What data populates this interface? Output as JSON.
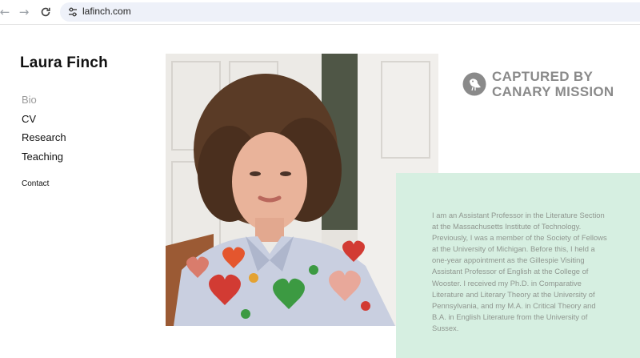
{
  "browser": {
    "url": "lafinch.com",
    "back_icon": "arrow-left-icon",
    "forward_icon": "arrow-right-icon",
    "reload_icon": "reload-icon",
    "site_info_icon": "tune-icon"
  },
  "site": {
    "title": "Laura Finch",
    "nav": [
      {
        "label": "Bio",
        "active": true
      },
      {
        "label": "CV",
        "active": false
      },
      {
        "label": "Research",
        "active": false
      },
      {
        "label": "Teaching",
        "active": false
      }
    ],
    "contact": "Contact"
  },
  "watermark": {
    "line1": "CAPTURED BY",
    "line2": "CANARY MISSION",
    "icon": "canary-bird-icon"
  },
  "bio": {
    "text": "I am an Assistant Professor in the Literature Section at the Massachusetts Institute of Technology. Previously, I was a member of the Society of Fellows at the University of Michigan. Before this, I held a one-year appointment as the Gillespie Visiting Assistant Professor of English at the College of Wooster. I received my Ph.D. in Comparative Literature and Literary Theory at the University of Pennsylvania, and my M.A. in Critical Theory and B.A. in English Literature from the University of Sussex."
  },
  "colors": {
    "bio_panel": "#d6efe1",
    "bio_text": "#8f968f",
    "watermark": "#8a8a8a",
    "nav_active": "#9a9a9a"
  }
}
